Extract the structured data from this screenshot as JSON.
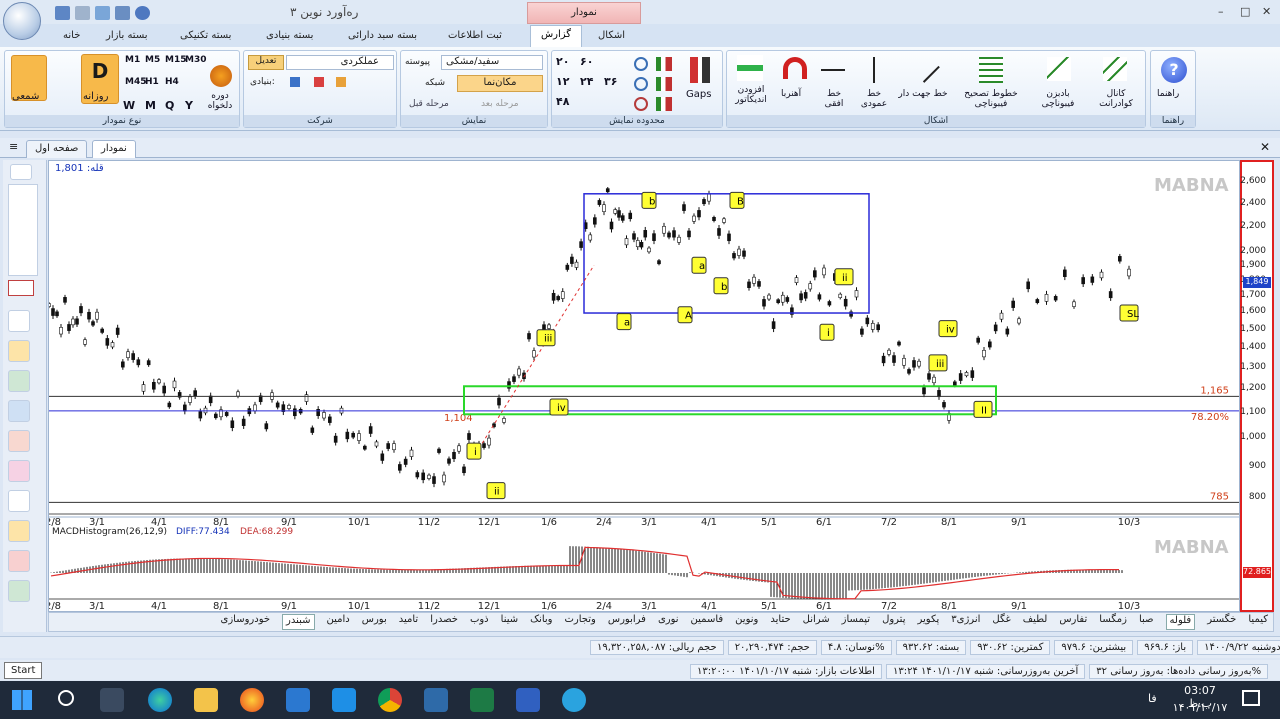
{
  "app": {
    "title": "ره‌آورد نوین ۳",
    "context_tab": "نمودار"
  },
  "ribbon_tabs": [
    "خانه",
    "بسته بازار",
    "بسته تکنیکی",
    "بسته بنیادی",
    "بسته سبد دارائی",
    "ثبت اطلاعات",
    "گزارش",
    "اشکال"
  ],
  "groups": {
    "chart_type": {
      "label": "نوع نمودار",
      "daily": "روزانه",
      "periodic": "دوره دلخواه",
      "candle": "شمعی",
      "periods": [
        "M1",
        "M5",
        "M15",
        "M30",
        "M45",
        "H1",
        "H4",
        "W",
        "M",
        "Q",
        "Y"
      ]
    },
    "company": {
      "label": "شرکت",
      "name": "عملکردی",
      "adjust": "تعدیل",
      "fundamental": "بنیادی:"
    },
    "display": {
      "label": "نمایش",
      "theme": "سفید/مشکی",
      "continuous": "پیوسته",
      "grid": "شبکه",
      "cursor": "مکان‌نما",
      "prev_step": "مرحله قبل",
      "next_step": "مرحله بعد"
    },
    "range": {
      "label": "محدوده نمایش",
      "gaps": "Gaps",
      "buttons": [
        "۲۰",
        "۶۰",
        "۱۲",
        "۲۴",
        "۳۶",
        "۴۸"
      ]
    },
    "shapes": {
      "label": "اشکال",
      "items": [
        "افزودن اندیکاتور",
        "آهنربا",
        "خط افقی",
        "خط عمودی",
        "خط جهت دار",
        "خطوط تصحیح فیبوناچی",
        "بادبزن فیبوناچی",
        "کانال کوادرانت"
      ]
    },
    "help": {
      "label": "راهنما",
      "item": "راهنما"
    }
  },
  "doc_tabs": [
    "نمودار",
    "صفحه اول"
  ],
  "chart": {
    "watermark": "MABNA",
    "peak_label": "قله: 1,801",
    "indicator_label": "MACDHistogram(26,12,9)",
    "diff": "DIFF:77.434",
    "dea": "DEA:68.299",
    "current_price": "1,849",
    "macd_value": "72.865",
    "levels": {
      "l1165": "1,165",
      "l1104": "1,104",
      "fib": "78.20%",
      "l785": "785"
    },
    "wave_labels": [
      "i",
      "ii",
      "iii",
      "iv",
      "a",
      "b",
      "A",
      "B",
      "a",
      "b",
      "i",
      "ii",
      "iii",
      "iv",
      "II",
      "SL"
    ],
    "x_ticks": [
      "2/8",
      "3/1",
      "4/1",
      "8/1",
      "9/1",
      "10/1",
      "11/2",
      "12/1",
      "1/6",
      "2/4",
      "3/1",
      "4/1",
      "5/1",
      "6/1",
      "7/2",
      "8/1",
      "9/1",
      "10/3"
    ]
  },
  "chart_data": {
    "type": "line",
    "title": "",
    "y_ticks": [
      800,
      900,
      1000,
      1100,
      1200,
      1300,
      1400,
      1500,
      1600,
      1700,
      1800,
      1900,
      2000,
      2200,
      2400,
      2600
    ],
    "x": [
      "2/8",
      "3/1",
      "4/1",
      "8/1",
      "9/1",
      "10/1",
      "11/2",
      "12/1",
      "1/6",
      "2/4",
      "3/1",
      "4/1",
      "5/1",
      "6/1",
      "7/2",
      "8/1",
      "9/1",
      "10/3"
    ],
    "series": [
      {
        "values": [
          1590,
          1510,
          1200,
          1090,
          1130,
          1010,
          870,
          1000,
          1550,
          2400,
          2000,
          2350,
          1600,
          1800,
          1400,
          1150,
          1650,
          1849
        ]
      }
    ]
  },
  "symbols": [
    "کیمیا",
    "خگستر",
    "فلوله",
    "صبا",
    "زمگسا",
    "تفارس",
    "لطیف",
    "غگل",
    "انرژی۳",
    "پکویر",
    "پترول",
    "تپمساز",
    "شرانل",
    "حتاید",
    "ونوین",
    "فاسمین",
    "نوری",
    "فرابورس",
    "وتجارت",
    "وبانک",
    "شینا",
    "ذوب",
    "خصدرا",
    "تامید",
    "بورس",
    "دامین",
    "شبندر",
    "خودروسازی"
  ],
  "status1": [
    "دوشنبه ۱۴۰۰/۹/۲۲",
    "باز: ۹۶۹.۶",
    "بیشترین: ۹۷۹.۶",
    "کمترین: ۹۳۰.۶۲",
    "بسته: ۹۳۲.۶۲",
    "نوسان: ۴.۸%",
    "حجم: ۲۰,۲۹۰,۴۷۴",
    "حجم ریالی: ۱۹,۳۲۰,۲۵۸,۰۸۷"
  ],
  "status2": [
    "به‌روز رسانی داده‌ها: به‌روز رسانی ۳۲%",
    "آخرین به‌روزرسانی: شنبه ۱۴۰۱/۱۰/۱۷ ۱۳:۲۴",
    "اطلاعات بازار: شنبه ۱۴۰۱/۱۰/۱۷ ۱۳:۲۰:۰۰"
  ],
  "tooltip": "Start",
  "taskbar": {
    "time": "03:07 ب.ظ",
    "date": "۱۴۰۱/۱۰/۱۷",
    "lang": "فا"
  }
}
